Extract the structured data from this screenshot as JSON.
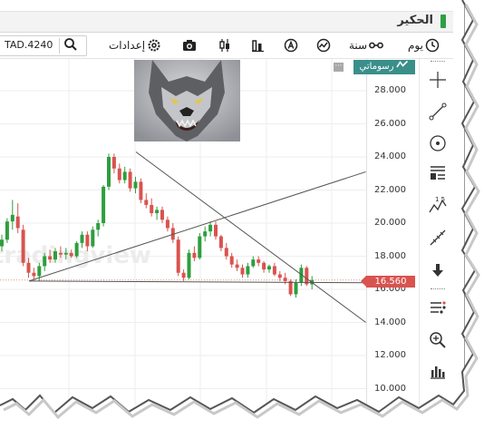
{
  "window": {
    "title": "الحكير",
    "accent": "#2ea043"
  },
  "toolbar": {
    "symbol_value": "TAD.4240",
    "settings_label": "إعدادات",
    "period_year_label": "سنة",
    "interval_day_label": "يوم"
  },
  "indicator": {
    "label": "رسوماتي"
  },
  "price_axis": {
    "ticks": [
      "28.000",
      "26.000",
      "24.000",
      "22.000",
      "20.000",
      "18.000",
      "16.000",
      "14.000",
      "12.000",
      "10.000"
    ]
  },
  "last_price": {
    "value": "16.560",
    "color": "#d9534f"
  },
  "watermark_text": "tradingview",
  "chart_data": {
    "type": "candlestick",
    "y_range": [
      10,
      29
    ],
    "up_color": "#2e9e3e",
    "down_color": "#d9534f",
    "candles": [
      [
        18.6,
        19.3,
        18.3,
        19.0
      ],
      [
        19.0,
        20.3,
        18.8,
        20.1
      ],
      [
        20.1,
        21.4,
        19.6,
        20.5
      ],
      [
        20.4,
        21.2,
        19.4,
        19.7
      ],
      [
        19.6,
        19.9,
        17.4,
        17.6
      ],
      [
        17.6,
        17.9,
        16.7,
        17.0
      ],
      [
        17.0,
        17.3,
        16.5,
        16.8
      ],
      [
        16.8,
        17.6,
        16.5,
        17.4
      ],
      [
        17.4,
        18.2,
        17.1,
        18.0
      ],
      [
        18.0,
        18.4,
        17.6,
        17.8
      ],
      [
        17.8,
        18.5,
        17.6,
        18.3
      ],
      [
        18.2,
        18.6,
        17.9,
        18.1
      ],
      [
        18.1,
        18.5,
        17.8,
        18.2
      ],
      [
        18.2,
        18.4,
        17.9,
        18.0
      ],
      [
        18.0,
        18.9,
        17.9,
        18.8
      ],
      [
        18.8,
        19.5,
        18.5,
        19.3
      ],
      [
        19.3,
        19.5,
        18.3,
        18.6
      ],
      [
        18.6,
        19.8,
        18.5,
        19.6
      ],
      [
        19.6,
        20.2,
        19.2,
        20.0
      ],
      [
        20.0,
        22.3,
        19.8,
        22.2
      ],
      [
        22.2,
        24.2,
        22.0,
        24.0
      ],
      [
        24.0,
        24.2,
        23.0,
        23.3
      ],
      [
        23.3,
        23.6,
        22.4,
        22.6
      ],
      [
        22.6,
        23.4,
        22.4,
        23.1
      ],
      [
        23.1,
        23.3,
        21.9,
        22.1
      ],
      [
        22.1,
        22.8,
        21.8,
        22.5
      ],
      [
        22.5,
        22.7,
        21.2,
        21.4
      ],
      [
        21.4,
        21.8,
        20.9,
        21.1
      ],
      [
        21.1,
        21.5,
        20.4,
        20.6
      ],
      [
        20.6,
        21.0,
        20.2,
        20.8
      ],
      [
        20.8,
        21.0,
        20.0,
        20.2
      ],
      [
        20.2,
        20.4,
        19.5,
        19.7
      ],
      [
        19.7,
        20.0,
        18.8,
        19.0
      ],
      [
        19.0,
        19.2,
        16.8,
        17.0
      ],
      [
        17.0,
        17.2,
        16.5,
        16.7
      ],
      [
        16.7,
        18.4,
        16.6,
        18.2
      ],
      [
        18.2,
        18.6,
        17.7,
        17.9
      ],
      [
        17.9,
        19.4,
        17.8,
        19.2
      ],
      [
        19.2,
        19.8,
        18.9,
        19.5
      ],
      [
        19.5,
        20.1,
        19.2,
        19.9
      ],
      [
        19.9,
        20.1,
        19.0,
        19.2
      ],
      [
        19.2,
        19.3,
        18.3,
        18.5
      ],
      [
        18.5,
        18.8,
        17.8,
        18.0
      ],
      [
        18.0,
        18.2,
        17.3,
        17.5
      ],
      [
        17.5,
        17.8,
        17.1,
        17.3
      ],
      [
        17.3,
        17.5,
        16.7,
        16.9
      ],
      [
        16.9,
        17.6,
        16.7,
        17.4
      ],
      [
        17.4,
        18.0,
        17.3,
        17.8
      ],
      [
        17.8,
        18.0,
        17.4,
        17.6
      ],
      [
        17.6,
        17.7,
        17.0,
        17.2
      ],
      [
        17.2,
        17.5,
        17.0,
        17.4
      ],
      [
        17.4,
        17.6,
        16.8,
        16.9
      ],
      [
        16.9,
        17.1,
        16.5,
        16.7
      ],
      [
        16.7,
        17.0,
        16.3,
        16.5
      ],
      [
        16.5,
        16.6,
        15.6,
        15.7
      ],
      [
        15.7,
        16.6,
        15.5,
        16.4
      ],
      [
        16.4,
        17.5,
        16.2,
        17.3
      ],
      [
        17.3,
        17.4,
        16.2,
        16.3
      ],
      [
        16.3,
        16.8,
        16.0,
        16.56
      ]
    ],
    "trendlines": [
      {
        "from": [
          0,
          16.5
        ],
        "to": [
          64,
          16.4
        ]
      },
      {
        "from": [
          20,
          24.3
        ],
        "to": [
          64,
          14.0
        ]
      },
      {
        "from": [
          0,
          16.5
        ],
        "to": [
          64,
          23.1
        ]
      }
    ]
  }
}
